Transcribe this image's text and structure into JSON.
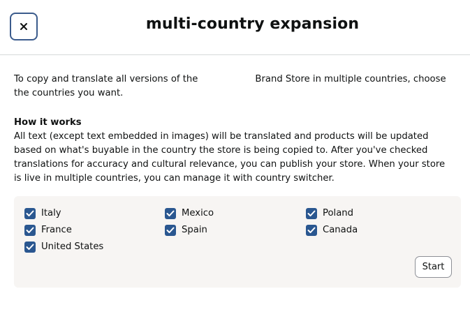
{
  "header": {
    "title": "multi-country expansion",
    "close_icon": "close-icon"
  },
  "intro": {
    "text_before": "To copy and translate all versions of the",
    "text_after": "Brand Store in multiple countries, choose the countries you want."
  },
  "how_it_works": {
    "title": "How it works",
    "body": "All text (except text embedded in images) will be translated and products will be updated based on what's buyable in the country the store is being copied to. After you've checked translations for accuracy and cultural relevance, you can publish your store. When your store is live in multiple countries, you can manage it with country switcher."
  },
  "countries": [
    {
      "label": "Italy",
      "checked": true
    },
    {
      "label": "Mexico",
      "checked": true
    },
    {
      "label": "Poland",
      "checked": true
    },
    {
      "label": "France",
      "checked": true
    },
    {
      "label": "Spain",
      "checked": true
    },
    {
      "label": "Canada",
      "checked": true
    },
    {
      "label": "United States",
      "checked": true
    }
  ],
  "actions": {
    "start_label": "Start"
  },
  "colors": {
    "checkbox": "#2a5790",
    "close_border": "#3b5b8c",
    "panel_bg": "#f7f5f3"
  }
}
